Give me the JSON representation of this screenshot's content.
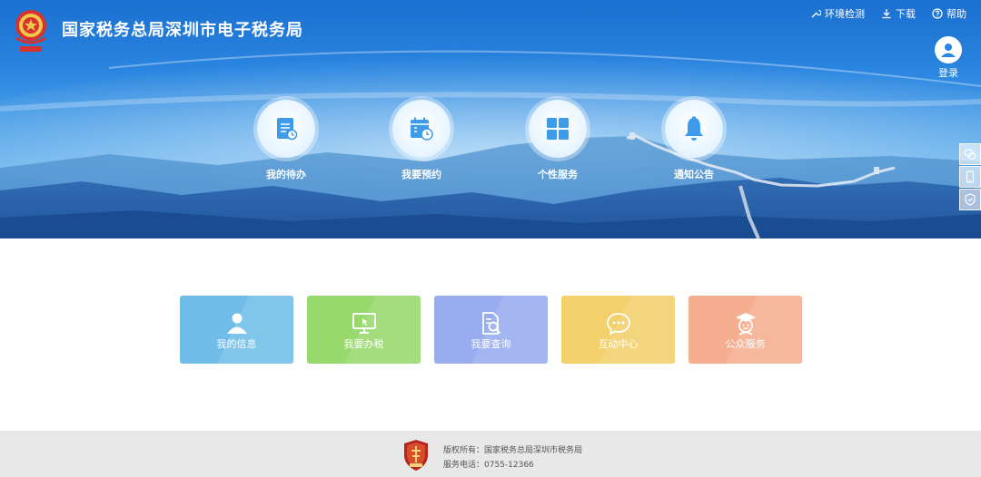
{
  "header": {
    "title": "国家税务总局深圳市电子税务局",
    "links": [
      {
        "label": "环境检测",
        "icon": "wrench-icon"
      },
      {
        "label": "下载",
        "icon": "download-icon"
      },
      {
        "label": "帮助",
        "icon": "help-icon"
      }
    ],
    "login_label": "登录"
  },
  "nav": [
    {
      "label": "我的待办",
      "icon": "todo-list-icon"
    },
    {
      "label": "我要预约",
      "icon": "calendar-clock-icon"
    },
    {
      "label": "个性服务",
      "icon": "grid-icon"
    },
    {
      "label": "通知公告",
      "icon": "bell-icon"
    }
  ],
  "side_tools": [
    "wechat-icon",
    "mobile-icon",
    "shield-icon"
  ],
  "cards": [
    {
      "label": "我的信息",
      "icon": "user-icon",
      "color": "#6fbde8"
    },
    {
      "label": "我要办税",
      "icon": "monitor-icon",
      "color": "#97d96c"
    },
    {
      "label": "我要查询",
      "icon": "search-document-icon",
      "color": "#98acef"
    },
    {
      "label": "互动中心",
      "icon": "chat-icon",
      "color": "#f2d06b"
    },
    {
      "label": "公众服务",
      "icon": "graduate-icon",
      "color": "#f5ae90"
    }
  ],
  "footer": {
    "copyright": "版权所有：国家税务总局深圳市税务局",
    "phone": "服务电话：0755-12366"
  },
  "colors": {
    "brand_blue": "#1b6fd0",
    "footer_bg": "#e8e8e8",
    "icon_blue": "#3d9be9"
  }
}
